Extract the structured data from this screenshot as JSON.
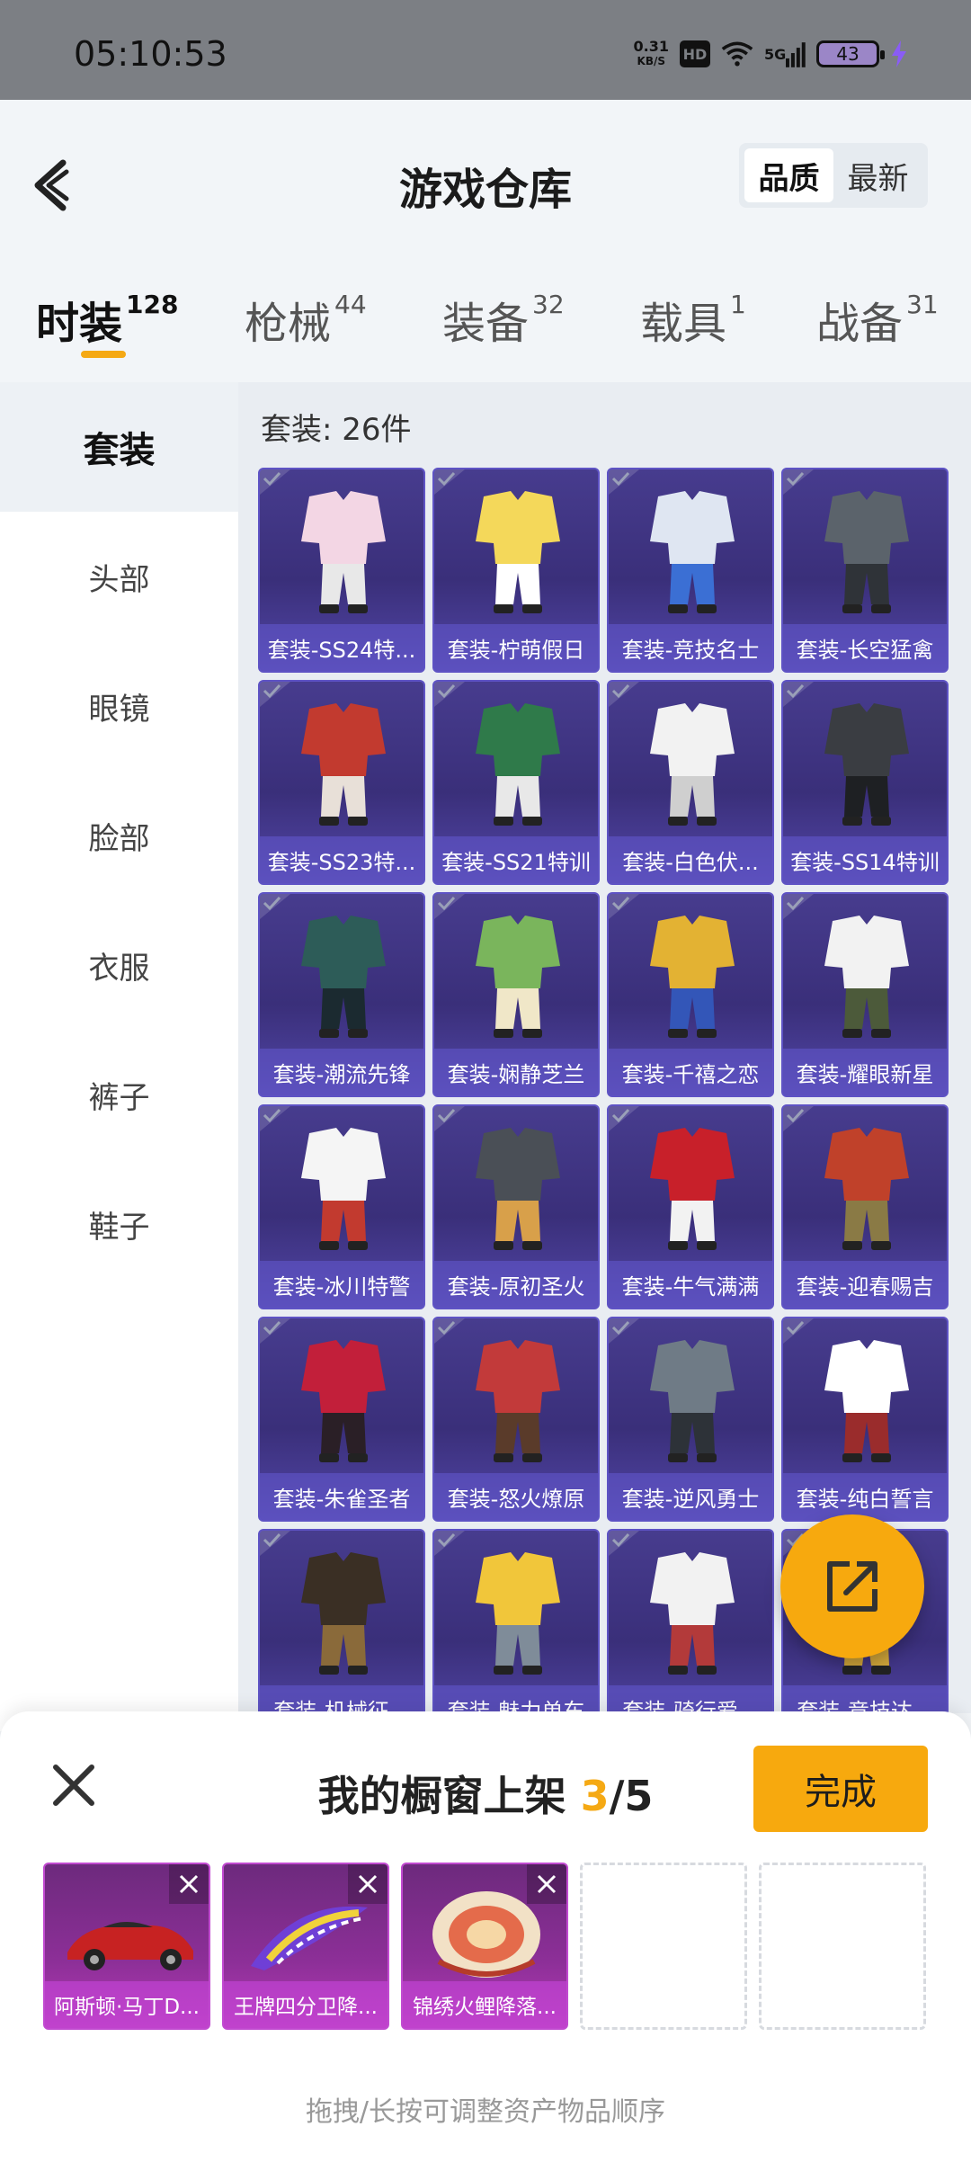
{
  "status_bar": {
    "time": "05:10:53",
    "net_speed_value": "0.31",
    "net_speed_unit": "KB/S",
    "hd_label": "HD",
    "signal_label": "5G",
    "battery": "43"
  },
  "header": {
    "title": "游戏仓库",
    "sort_options": [
      "品质",
      "最新"
    ],
    "active_sort": "品质"
  },
  "tabs": [
    {
      "label": "时装",
      "count": "128",
      "active": true
    },
    {
      "label": "枪械",
      "count": "44"
    },
    {
      "label": "装备",
      "count": "32"
    },
    {
      "label": "载具",
      "count": "1"
    },
    {
      "label": "战备",
      "count": "31"
    }
  ],
  "categories": [
    "套装",
    "头部",
    "眼镜",
    "脸部",
    "衣服",
    "裤子",
    "鞋子"
  ],
  "active_category": "套装",
  "content": {
    "count_label": "套装: 26件"
  },
  "items": [
    "套装-SS24特...",
    "套装-柠萌假日",
    "套装-竞技名士",
    "套装-长空猛禽",
    "套装-SS23特...",
    "套装-SS21特训",
    "套装-白色伏...",
    "套装-SS14特训",
    "套装-潮流先锋",
    "套装-娴静芝兰",
    "套装-千禧之恋",
    "套装-耀眼新星",
    "套装-冰川特警",
    "套装-原初圣火",
    "套装-牛气满满",
    "套装-迎春赐吉",
    "套装-朱雀圣者",
    "套装-怒火燎原",
    "套装-逆风勇士",
    "套装-纯白誓言",
    "套装-机械征...",
    "套装-魅力单车",
    "套装-骑行爱...",
    "套装-竞技达..."
  ],
  "sheet": {
    "title_prefix": "我的橱窗上架 ",
    "current": "3",
    "total": "/5",
    "done_label": "完成",
    "slots": [
      {
        "name": "阿斯顿·马丁D...",
        "icon": "car-icon"
      },
      {
        "name": "王牌四分卫降...",
        "icon": "glider-icon"
      },
      {
        "name": "锦绣火鲤降落...",
        "icon": "parachute-icon"
      }
    ],
    "hint": "拖拽/长按可调整资产物品顺序"
  },
  "colors": {
    "accent": "#f7a90e",
    "card_bg": "#3a2f7a",
    "slot_bg": "#8d2f98"
  }
}
